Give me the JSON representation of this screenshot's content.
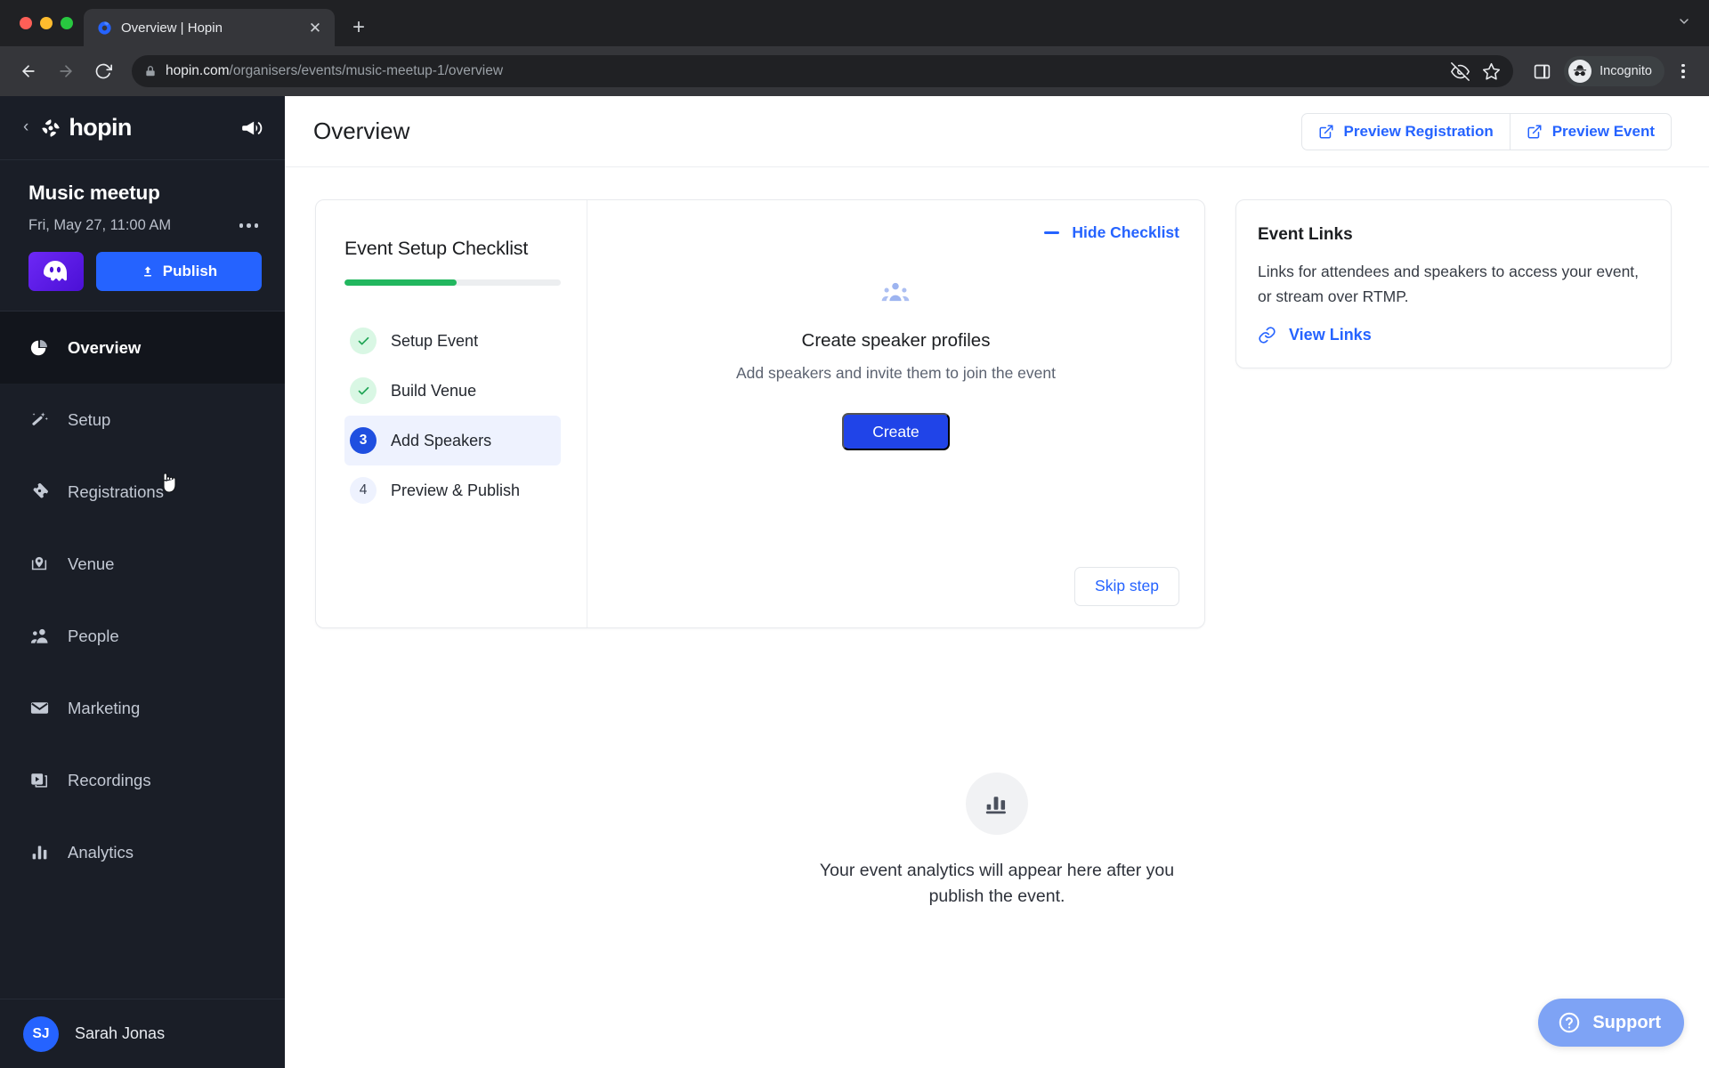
{
  "browser": {
    "tab": {
      "title": "Overview | Hopin",
      "favicon": "hopin-favicon",
      "close_label": "✕"
    },
    "new_tab_label": "+",
    "tab_list_chevron": "chevron-down-icon",
    "nav": {
      "back": "←",
      "forward": "→",
      "reload": "↻"
    },
    "omnibox": {
      "lock": "lock-icon",
      "domain": "hopin.com",
      "path": "/organisers/events/music-meetup-1/overview"
    },
    "toolbar_icons": [
      "eye-off-icon",
      "star-icon",
      "side-panel-icon"
    ],
    "profile": {
      "label": "Incognito",
      "icon": "incognito-icon"
    },
    "menu": "kebab-menu-icon"
  },
  "sidebar": {
    "back_chevron": "‹",
    "brand": "hopin",
    "announce_icon": "megaphone-icon",
    "event": {
      "name": "Music meetup",
      "datetime": "Fri, May 27, 11:00 AM",
      "more_label": "more-options",
      "avatar_icon": "ghost-avatar",
      "publish_label": "Publish",
      "publish_icon": "upload-icon"
    },
    "items": [
      {
        "label": "Overview",
        "icon": "pie-chart-icon",
        "active": true
      },
      {
        "label": "Setup",
        "icon": "magic-wand-icon",
        "active": false
      },
      {
        "label": "Registrations",
        "icon": "ticket-icon",
        "active": false
      },
      {
        "label": "Venue",
        "icon": "map-pin-icon",
        "active": false
      },
      {
        "label": "People",
        "icon": "people-icon",
        "active": false
      },
      {
        "label": "Marketing",
        "icon": "envelope-icon",
        "active": false
      },
      {
        "label": "Recordings",
        "icon": "video-stack-icon",
        "active": false
      },
      {
        "label": "Analytics",
        "icon": "bar-chart-icon",
        "active": false
      }
    ],
    "user": {
      "initials": "SJ",
      "name": "Sarah Jonas"
    }
  },
  "header": {
    "title": "Overview",
    "preview_registration": "Preview Registration",
    "preview_event": "Preview Event",
    "external_link_icon": "external-link-icon"
  },
  "checklist": {
    "title": "Event Setup Checklist",
    "progress_percent": 52,
    "hide_label": "Hide Checklist",
    "steps": [
      {
        "number": "1",
        "label": "Setup Event",
        "state": "done"
      },
      {
        "number": "2",
        "label": "Build Venue",
        "state": "done"
      },
      {
        "number": "3",
        "label": "Add Speakers",
        "state": "current"
      },
      {
        "number": "4",
        "label": "Preview & Publish",
        "state": "todo"
      }
    ],
    "panel": {
      "icon": "speakers-group-icon",
      "title": "Create speaker profiles",
      "subtitle": "Add speakers and invite them to join the event",
      "create_label": "Create",
      "skip_label": "Skip step"
    }
  },
  "event_links": {
    "title": "Event Links",
    "description": "Links for attendees and speakers to access your event, or stream over RTMP.",
    "link_label": "View Links",
    "link_icon": "chain-link-icon"
  },
  "analytics_placeholder": {
    "icon": "bar-chart-icon",
    "text": "Your event analytics will appear here after you publish the event."
  },
  "support": {
    "label": "Support",
    "icon": "question-circle-icon"
  },
  "colors": {
    "accent_blue": "#2563ff",
    "primary_button": "#2044e8",
    "progress_green": "#22b75f",
    "sidebar_bg": "#1a1e27",
    "sidebar_active": "#12151c",
    "support_blue": "#7ea3f5"
  }
}
